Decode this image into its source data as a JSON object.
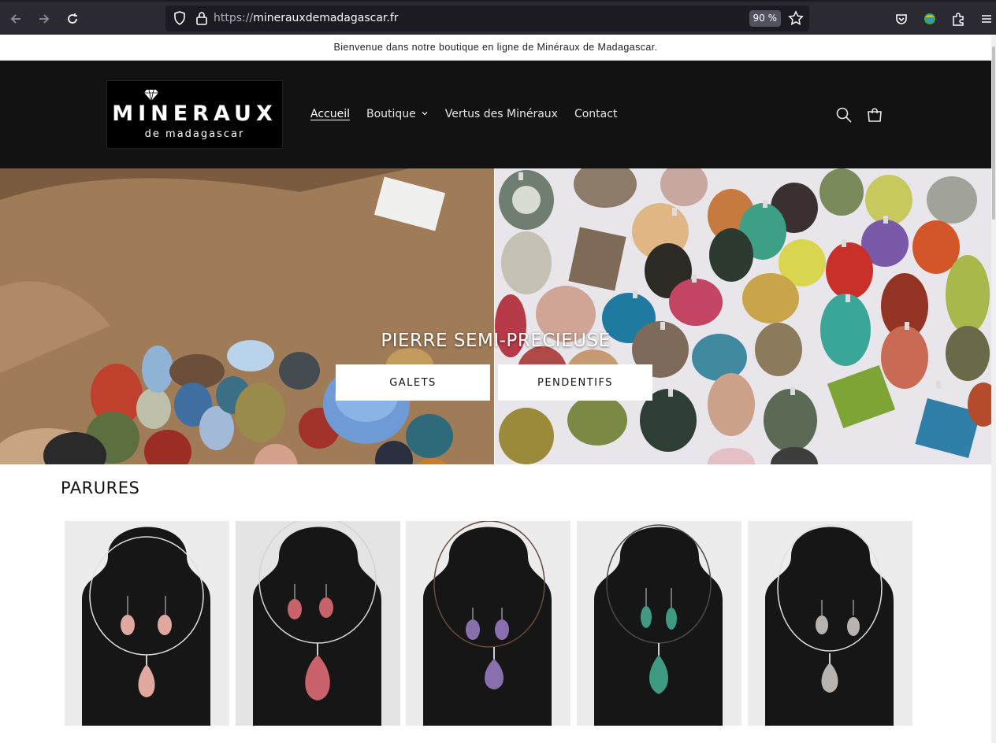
{
  "browser": {
    "url_protocol": "https://",
    "url_host": "minerauxdemadagascar.fr",
    "zoom": "90 %",
    "icons": [
      "back-arrow-icon",
      "forward-arrow-icon",
      "reload-icon",
      "shield-icon",
      "lock-icon",
      "star-icon",
      "pocket-icon",
      "account-icon",
      "extensions-icon",
      "menu-icon"
    ]
  },
  "announcement": {
    "text": "Bienvenue dans notre boutique en ligne de Minéraux de Madagascar."
  },
  "header": {
    "logo_title": "MINERAUX",
    "logo_subtitle": "de madagascar",
    "nav": [
      {
        "label": "Accueil",
        "active": true
      },
      {
        "label": "Boutique",
        "has_dropdown": true
      },
      {
        "label": "Vertus des Minéraux"
      },
      {
        "label": "Contact"
      }
    ],
    "icons": [
      "search-icon",
      "cart-icon"
    ]
  },
  "hero": {
    "heading": "PIERRE SEMI-PRECIEUSE",
    "buttons": [
      {
        "label": "GALETS"
      },
      {
        "label": "PENDENTIFS"
      }
    ]
  },
  "collection": {
    "title": "PARURES",
    "products": [
      {
        "stone_color": "#e0a9a0"
      },
      {
        "stone_color": "#c9626b"
      },
      {
        "stone_color": "#8a6fae"
      },
      {
        "stone_color": "#3f9a84"
      },
      {
        "stone_color": "#b9b3b0"
      }
    ]
  },
  "colors": {
    "header_bg": "#121212",
    "chrome_bg": "#2b2a33",
    "button_bg": "#ffffff"
  }
}
